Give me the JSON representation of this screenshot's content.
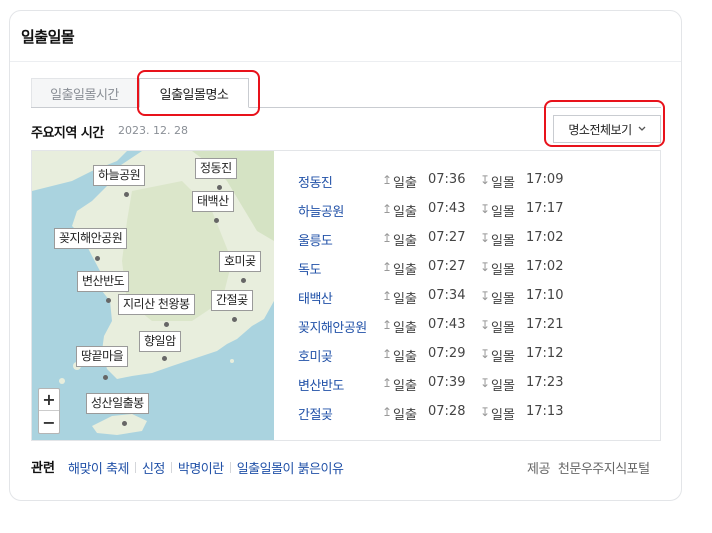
{
  "card_title": "일출일몰",
  "tabs": [
    {
      "label": "일출일몰시간",
      "active": false
    },
    {
      "label": "일출일몰명소",
      "active": true
    }
  ],
  "region": {
    "title": "주요지역 시간",
    "date": "2023. 12. 28"
  },
  "view_all": {
    "label": "명소전체보기",
    "icon": "chevron-down-icon"
  },
  "map": {
    "markers": [
      "하늘공원",
      "정동진",
      "태백산",
      "꽂지해안공원",
      "호미곶",
      "변산반도",
      "지리산 천왕봉",
      "간절곶",
      "향일암",
      "땅끝마을",
      "성산일출봉"
    ],
    "zoom_in": "+",
    "zoom_out": "−"
  },
  "sunrise_label": "일출",
  "sunset_label": "일몰",
  "rows": [
    {
      "name": "정동진",
      "sunrise": "07:36",
      "sunset": "17:09"
    },
    {
      "name": "하늘공원",
      "sunrise": "07:43",
      "sunset": "17:17"
    },
    {
      "name": "울릉도",
      "sunrise": "07:27",
      "sunset": "17:02"
    },
    {
      "name": "독도",
      "sunrise": "07:27",
      "sunset": "17:02"
    },
    {
      "name": "태백산",
      "sunrise": "07:34",
      "sunset": "17:10"
    },
    {
      "name": "꽂지해안공원",
      "sunrise": "07:43",
      "sunset": "17:21"
    },
    {
      "name": "호미곶",
      "sunrise": "07:29",
      "sunset": "17:12"
    },
    {
      "name": "변산반도",
      "sunrise": "07:39",
      "sunset": "17:23"
    },
    {
      "name": "간절곶",
      "sunrise": "07:28",
      "sunset": "17:13"
    }
  ],
  "related": {
    "label": "관련",
    "links": [
      "해맞이 축제",
      "신정",
      "박명이란",
      "일출일몰이 붉은이유"
    ]
  },
  "source": {
    "label": "제공",
    "name": "천문우주지식포털"
  },
  "colors": {
    "annotation": "#e8121b",
    "link": "#2252a8",
    "sea": "#aad3df",
    "land": "#e9efe0"
  }
}
